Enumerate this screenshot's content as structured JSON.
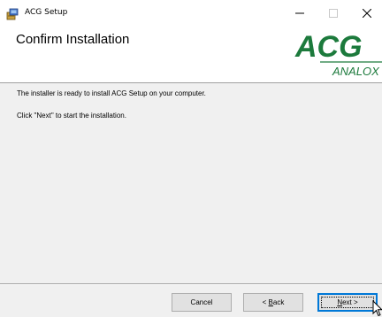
{
  "window": {
    "title": "ACG Setup",
    "icon": "installer-icon",
    "controls": [
      "minimize-icon",
      "maximize-icon",
      "close-icon"
    ]
  },
  "banner": {
    "title": "Confirm Installation",
    "logo_big": "ACG",
    "logo_small": "ANALOX",
    "logo_color": "#1c7a3c"
  },
  "content": {
    "line1": "The installer is ready to install ACG Setup on your computer.",
    "line2": "Click \"Next\" to start the installation."
  },
  "buttons": {
    "cancel": "Cancel",
    "back_prefix": "< ",
    "back_mnemonic": "B",
    "back_rest": "ack",
    "next_mnemonic": "N",
    "next_rest": "ext >"
  }
}
